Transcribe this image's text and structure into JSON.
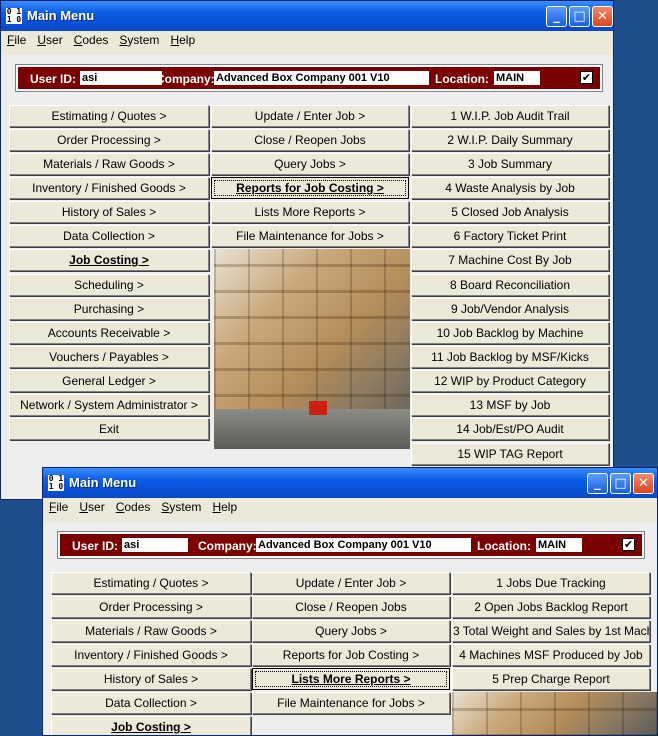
{
  "windows": [
    {
      "title": "Main Menu",
      "menu": [
        "File",
        "User",
        "Codes",
        "System",
        "Help"
      ],
      "info": {
        "user_label": "User ID:",
        "user": "asi",
        "company_label": "Company:",
        "company": "Advanced Box Company 001 V10",
        "location_label": "Location:",
        "location": "MAIN",
        "checked": "✔"
      },
      "col1": [
        "Estimating / Quotes >",
        "Order Processing >",
        "Materials / Raw Goods >",
        "Inventory / Finished Goods >",
        "History of Sales >",
        "Data Collection >",
        "Job Costing >",
        "Scheduling >",
        "Purchasing >",
        "Accounts Receivable >",
        "Vouchers / Payables >",
        "General Ledger >",
        "Network / System Administrator >",
        "Exit"
      ],
      "col2": [
        "Update / Enter Job >",
        "Close / Reopen Jobs",
        "Query Jobs >",
        "Reports for Job Costing >",
        "Lists More Reports >",
        "File Maintenance for Jobs >"
      ],
      "col3": [
        "1 W.I.P. Job Audit Trail",
        "2 W.I.P. Daily Summary",
        "3 Job Summary",
        "4 Waste Analysis by Job",
        "5 Closed Job Analysis",
        "6 Factory Ticket Print",
        "7 Machine Cost By Job",
        "8 Board Reconciliation",
        "9 Job/Vendor Analysis",
        "10 Job Backlog by Machine",
        "11 Job Backlog by MSF/Kicks",
        "12 WIP by Product Category",
        "13 MSF by Job",
        "14 Job/Est/PO Audit",
        "15 WIP TAG Report"
      ]
    },
    {
      "title": "Main Menu",
      "menu": [
        "File",
        "User",
        "Codes",
        "System",
        "Help"
      ],
      "info": {
        "user_label": "User ID:",
        "user": "asi",
        "company_label": "Company:",
        "company": "Advanced Box Company 001 V10",
        "location_label": "Location:",
        "location": "MAIN",
        "checked": "✔"
      },
      "col1": [
        "Estimating / Quotes >",
        "Order Processing >",
        "Materials / Raw Goods >",
        "Inventory / Finished Goods >",
        "History of Sales >",
        "Data Collection >",
        "Job Costing >"
      ],
      "col2": [
        "Update / Enter Job >",
        "Close / Reopen Jobs",
        "Query Jobs >",
        "Reports for Job Costing >",
        "Lists More Reports >",
        "File Maintenance for Jobs >"
      ],
      "col3": [
        "1 Jobs Due Tracking",
        "2 Open Jobs Backlog Report",
        "3 Total Weight and  Sales by 1st Mach",
        "4 Machines MSF Produced by Job",
        "5 Prep Charge Report"
      ]
    }
  ]
}
